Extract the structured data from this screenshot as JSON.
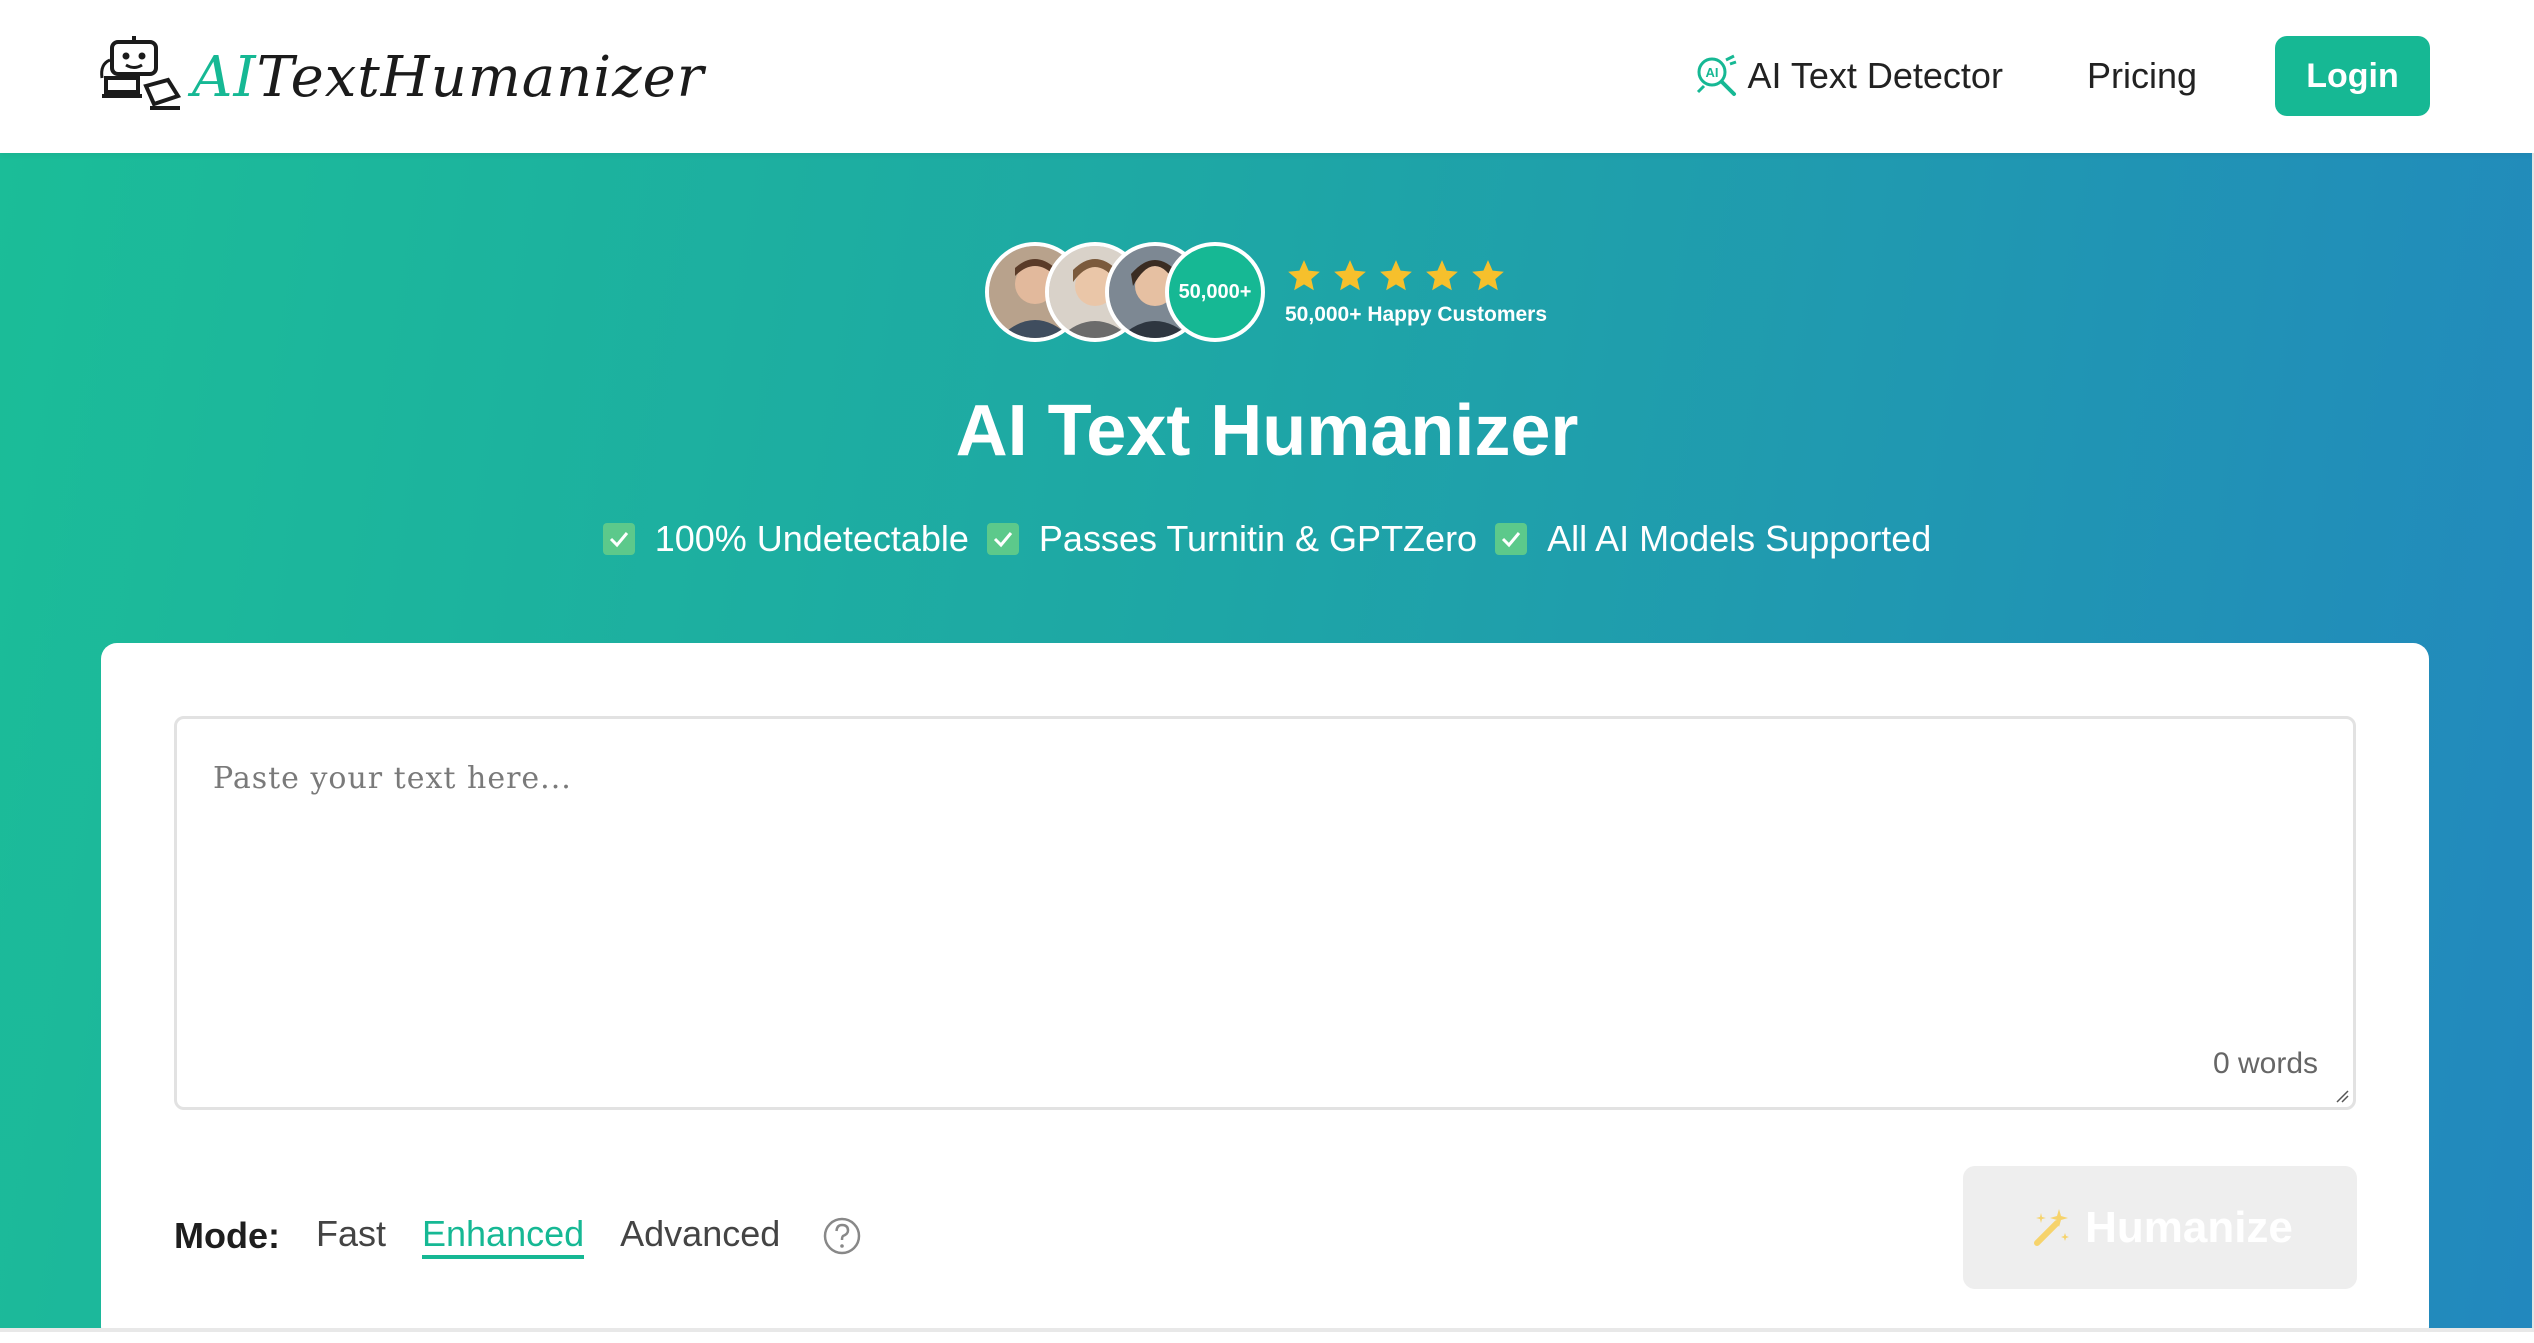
{
  "header": {
    "logo": {
      "prefix": "AI",
      "rest": "TextHumanizer",
      "icon": "robot-icon"
    },
    "nav": {
      "detector_label": "AI Text Detector",
      "detector_icon": "ai-search-icon",
      "pricing_label": "Pricing",
      "login_label": "Login"
    }
  },
  "hero": {
    "avatar_count": "50,000+",
    "rating_stars": 5,
    "customers_text": "50,000+ Happy Customers",
    "title": "AI Text Humanizer",
    "features": [
      "100% Undetectable",
      "Passes Turnitin & GPTZero",
      "All AI Models Supported"
    ]
  },
  "editor": {
    "placeholder": "Paste your text here...",
    "word_count": "0 words"
  },
  "mode": {
    "label": "Mode:",
    "options": [
      "Fast",
      "Enhanced",
      "Advanced"
    ],
    "selected": "Enhanced",
    "help_icon": "question-circle-icon"
  },
  "actions": {
    "humanize_label": "Humanize",
    "humanize_icon": "magic-wand-icon"
  },
  "colors": {
    "brand": "#16b894",
    "star": "#f6c02c",
    "gradient_start": "#1bbd98",
    "gradient_end": "#2288be",
    "disabled_button": "#eeeeee"
  }
}
